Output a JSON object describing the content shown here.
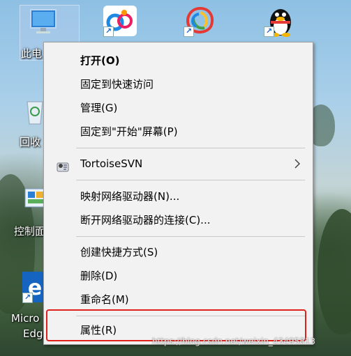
{
  "desktop": {
    "icons": [
      {
        "name": "this-pc",
        "label": "此电"
      },
      {
        "name": "recycle-bin",
        "label": "回收"
      },
      {
        "name": "control-panel",
        "label": "控制面"
      },
      {
        "name": "edge",
        "label_line1": "Micro",
        "label_line2": "Edg"
      }
    ]
  },
  "context_menu": {
    "items": [
      {
        "id": "open",
        "label": "打开(O)",
        "bold": true
      },
      {
        "id": "pin-quick-access",
        "label": "固定到快速访问"
      },
      {
        "id": "manage",
        "label": "管理(G)"
      },
      {
        "id": "pin-start",
        "label": "固定到\"开始\"屏幕(P)"
      },
      {
        "id": "tortoisesvn",
        "label": "TortoiseSVN",
        "has_submenu": true,
        "icon": "tortoisesvn-icon"
      },
      {
        "id": "map-drive",
        "label": "映射网络驱动器(N)..."
      },
      {
        "id": "disconnect-drive",
        "label": "断开网络驱动器的连接(C)..."
      },
      {
        "id": "create-shortcut",
        "label": "创建快捷方式(S)"
      },
      {
        "id": "delete",
        "label": "删除(D)"
      },
      {
        "id": "rename",
        "label": "重命名(M)"
      },
      {
        "id": "properties",
        "label": "属性(R)",
        "highlighted": true
      }
    ]
  },
  "highlight_color": "#e0201a",
  "watermark": "https://blog.csdn.net/weixin_43495813"
}
